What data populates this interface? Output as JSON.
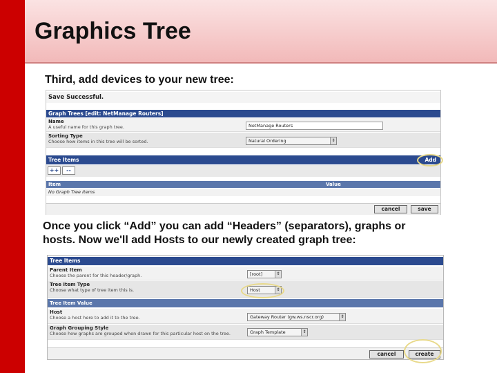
{
  "slide": {
    "title": "Graphics Tree",
    "caption_1": "Third, add devices to your new tree:",
    "caption_2_line1": "Once you click “Add” you can add “Headers” (separators), graphs or",
    "caption_2_line2": "hosts. Now we'll add Hosts to our newly created graph tree:"
  },
  "panel1": {
    "save_message": "Save Successful.",
    "graph_trees_header": "Graph Trees [edit: NetManage Routers]",
    "name_label": "Name",
    "name_desc": "A useful name for this graph tree.",
    "name_value": "NetManage Routers",
    "sorting_label": "Sorting Type",
    "sorting_desc": "Choose how items in this tree will be sorted.",
    "sorting_value": "Natural Ordering",
    "tree_items_header": "Tree Items",
    "add_link": "Add",
    "plus_label": "++",
    "minus_label": "--",
    "col_item": "Item",
    "col_value": "Value",
    "empty_text": "No Graph Tree Items",
    "cancel_button": "cancel",
    "save_button": "save"
  },
  "panel2": {
    "tree_items_header": "Tree Items",
    "parent_label": "Parent Item",
    "parent_desc": "Choose the parent for this header/graph.",
    "parent_value": "[root]",
    "type_label": "Tree Item Type",
    "type_desc": "Choose what type of tree item this is.",
    "type_value": "Host",
    "tree_item_value_header": "Tree Item Value",
    "host_label": "Host",
    "host_desc": "Choose a host here to add it to the tree.",
    "host_value": "Gateway Router (gw.ws.nscr.org)",
    "grouping_label": "Graph Grouping Style",
    "grouping_desc": "Choose how graphs are grouped when drawn for this particular host on the tree.",
    "grouping_value": "Graph Template",
    "cancel_button": "cancel",
    "create_button": "create"
  },
  "colors": {
    "accent_red": "#cc0000",
    "table_header_blue": "#2b4a8f",
    "highlight_oval": "#e8d98a"
  }
}
